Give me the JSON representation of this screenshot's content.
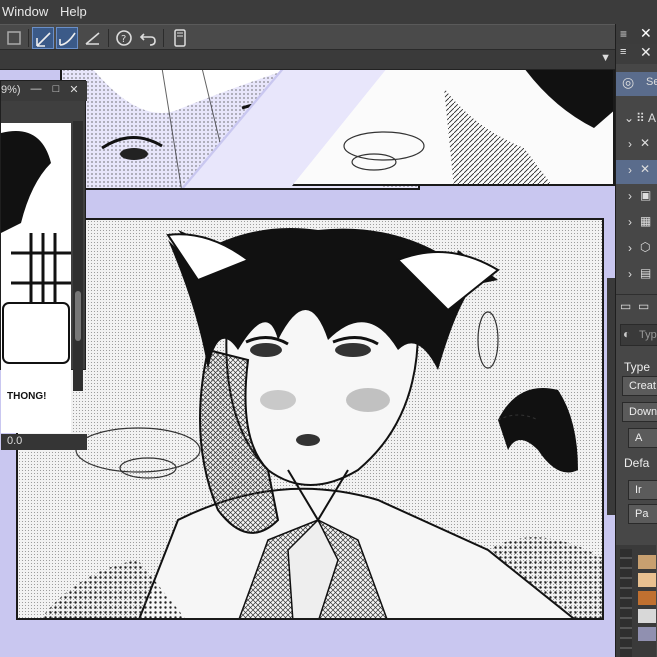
{
  "menubar": {
    "items": [
      "Window",
      "Help"
    ]
  },
  "subwindow": {
    "title": "9%)",
    "zoom": "0.0",
    "controls": [
      "minimize",
      "maximize",
      "close"
    ]
  },
  "canvas": {
    "art_text": "THONG!"
  },
  "right_panel": {
    "tab_label": "Se",
    "layer_header": "A",
    "search_placeholder": "Typ",
    "type_label": "Type",
    "buttons": [
      "Creat",
      "Down",
      "A",
      "Ir",
      "Pa"
    ],
    "default_label": "Defa"
  },
  "colors": {
    "ui_dark": "#2b2b2b",
    "ui_mid": "#474747",
    "canvas_bg": "#c9c7f0",
    "selection": "#5a6c8c",
    "active_tool": "#3b5a88"
  },
  "icons": [
    "brush-tool-icon",
    "stabilizer-icon",
    "ruler-icon",
    "help-icon",
    "undo-icon",
    "device-icon",
    "close-icon",
    "menu-icon",
    "layer-icon",
    "search-icon",
    "folder-icon"
  ]
}
